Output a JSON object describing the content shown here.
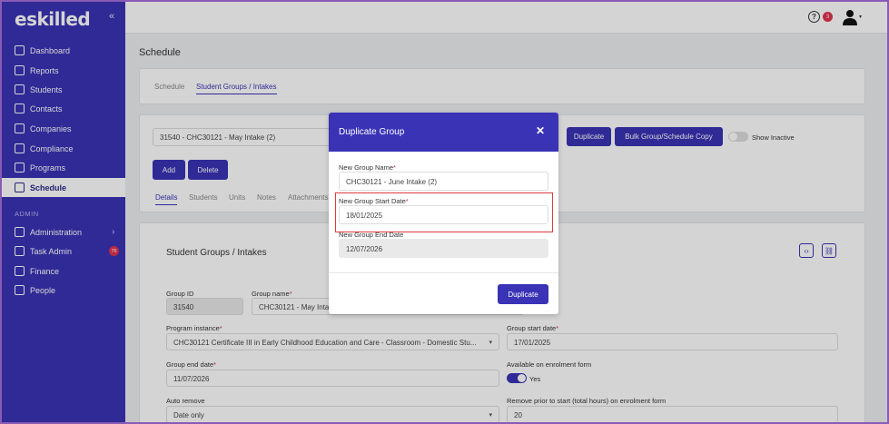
{
  "brand": {
    "logo_text": "eskilled",
    "accent": "#3a33b6",
    "badge_color": "#e0334d"
  },
  "sidebar": {
    "collapse_icon": "«",
    "items": [
      {
        "label": "Dashboard",
        "icon": "chart-line-icon"
      },
      {
        "label": "Reports",
        "icon": "report-icon"
      },
      {
        "label": "Students",
        "icon": "users-icon"
      },
      {
        "label": "Contacts",
        "icon": "contacts-icon"
      },
      {
        "label": "Companies",
        "icon": "building-icon"
      },
      {
        "label": "Compliance",
        "icon": "compliance-icon"
      },
      {
        "label": "Programs",
        "icon": "programs-icon"
      },
      {
        "label": "Schedule",
        "icon": "calendar-icon",
        "active": true
      }
    ],
    "admin_label": "ADMIN",
    "admin_items": [
      {
        "label": "Administration",
        "icon": "monitor-icon"
      },
      {
        "label": "Task Admin",
        "icon": "list-icon",
        "badge": "76"
      },
      {
        "label": "Finance",
        "icon": "coins-icon"
      },
      {
        "label": "People",
        "icon": "people-icon"
      }
    ]
  },
  "topbar": {
    "help_glyph": "?",
    "help_badge": "3",
    "user_caret": "▾"
  },
  "page": {
    "title": "Schedule",
    "tabs": [
      "Schedule",
      "Student Groups / Intakes"
    ],
    "group_select": "31540 - CHC30121 - May Intake (2)",
    "buttons": {
      "duplicate": "Duplicate",
      "bulk": "Bulk Group/Schedule Copy",
      "add": "Add",
      "delete": "Delete"
    },
    "show_inactive": "Show Inactive",
    "subtabs": [
      "Details",
      "Students",
      "Units",
      "Notes",
      "Attachments"
    ],
    "section_title": "Student Groups / Intakes",
    "form": {
      "group_id_label": "Group ID",
      "group_id_value": "31540",
      "group_name_label": "Group name",
      "group_name_value": "CHC30121 - May Intake",
      "program_instance_label": "Program instance",
      "program_instance_value": "CHC30121 Certificate III in Early Childhood Education and Care - Classroom - Domestic Stu...",
      "group_start_label": "Group start date",
      "group_start_value": "17/01/2025",
      "group_end_label": "Group end date",
      "group_end_value": "11/07/2026",
      "available_label": "Available on enrolment form",
      "available_value": "Yes",
      "auto_remove_label": "Auto remove",
      "auto_remove_value": "Date only",
      "remove_prior_label": "Remove prior to start (total hours) on enrolment form",
      "remove_prior_value": "20"
    }
  },
  "modal": {
    "title": "Duplicate Group",
    "close": "✕",
    "name_label": "New Group Name",
    "name_value": "CHC30121 - June Intake (2)",
    "start_label": "New Group Start Date",
    "start_value": "18/01/2025",
    "end_label": "New Group End Date",
    "end_value": "12/07/2026",
    "submit": "Duplicate",
    "required_mark": "*"
  }
}
